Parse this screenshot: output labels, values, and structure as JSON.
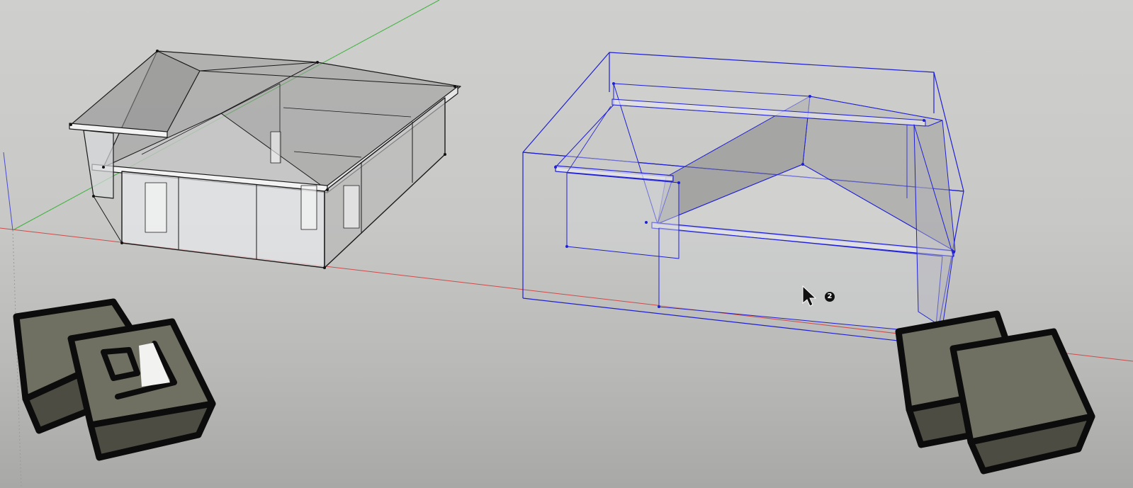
{
  "scene": {
    "background": "#cbcbc9",
    "axis_colors": {
      "red": "#d04a4a",
      "green": "#3cb33c",
      "blue": "#4a4ad8"
    },
    "selection_color": "#1f1fd6",
    "edge_color": "#1a1a1a",
    "glass_color": "#e9ecef"
  },
  "cursor": {
    "icon": "arrow-cursor-icon",
    "badge": "2"
  },
  "icons": {
    "left_component": "component-icon",
    "right_component": "component-icon"
  }
}
